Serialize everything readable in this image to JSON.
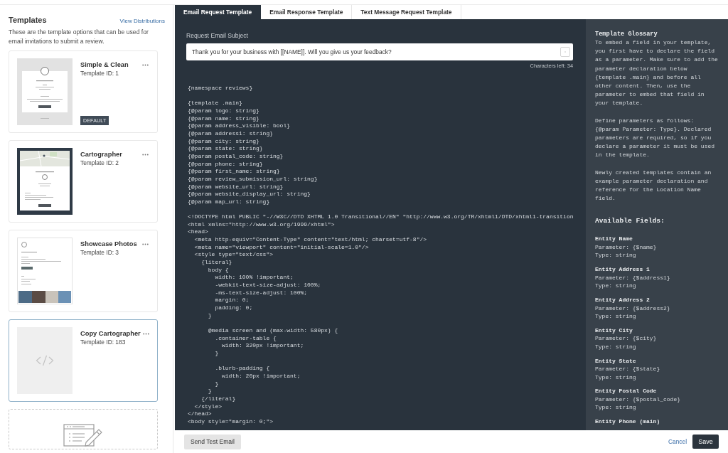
{
  "sidebar": {
    "title": "Templates",
    "link": "View Distributions",
    "description": "These are the template options that can be used for email invitations to submit a review.",
    "templates": [
      {
        "name": "Simple & Clean",
        "template_id": "Template ID: 1",
        "badge": "DEFAULT",
        "kind": "simple",
        "selected": false
      },
      {
        "name": "Cartographer",
        "template_id": "Template ID: 2",
        "kind": "map",
        "selected": false
      },
      {
        "name": "Showcase Photos",
        "template_id": "Template ID: 3",
        "kind": "photos",
        "selected": false
      },
      {
        "name": "Copy Cartographer",
        "template_id": "Template ID: 183",
        "kind": "code",
        "selected": true
      }
    ]
  },
  "tabs": [
    {
      "label": "Email Request Template",
      "selected": true
    },
    {
      "label": "Email Response Template",
      "selected": false
    },
    {
      "label": "Text Message Request Template",
      "selected": false
    }
  ],
  "editor": {
    "subject": {
      "label": "Request Email Subject",
      "value": "Thank you for your business with [[NAME]]. Will you give us your feedback?",
      "counter": "Characters left: 34"
    },
    "code": "{namespace reviews}\n\n{template .main}\n{@param logo: string}\n{@param name: string}\n{@param address_visible: bool}\n{@param address1: string}\n{@param city: string}\n{@param state: string}\n{@param postal_code: string}\n{@param phone: string}\n{@param first_name: string}\n{@param review_submission_url: string}\n{@param website_url: string}\n{@param website_display_url: string}\n{@param map_url: string}\n\n<!DOCTYPE html PUBLIC \"-//W3C//DTD XHTML 1.0 Transitional//EN\" \"http://www.w3.org/TR/xhtml1/DTD/xhtml1-transition\n<html xmlns=\"http://www.w3.org/1999/xhtml\">\n<head>\n  <meta http-equiv=\"Content-Type\" content=\"text/html; charset=utf-8\"/>\n  <meta name=\"viewport\" content=\"initial-scale=1.0\"/>\n  <style type=\"text/css\">\n    {literal}\n      body {\n        width: 100% !important;\n        -webkit-text-size-adjust: 100%;\n        -ms-text-size-adjust: 100%;\n        margin: 0;\n        padding: 0;\n      }\n\n      @media screen and (max-width: 580px) {\n        .container-table {\n          width: 320px !important;\n        }\n\n        .blurb-padding {\n          width: 20px !important;\n        }\n      }\n    {/literal}\n  </style>\n</head>\n<body style=\"margin: 0;\">"
  },
  "glossary": {
    "title": "Template Glossary",
    "paragraphs": [
      "To embed a field in your template, you first have to declare the field as a parameter. Make sure to add the parameter declaration below {template .main} and before all other content. Then, use the parameter to embed that field in your template.",
      "Define parameters as follows: {@param Parameter: Type}. Declared parameters are required, so if you declare a parameter it must be used in the template.",
      "Newly created templates contain an example parameter declaration and reference for the Location Name field."
    ],
    "fields_heading": "Available Fields:",
    "fields": [
      {
        "name": "Entity Name",
        "parameter": "Parameter: {$name}",
        "type": "Type: string"
      },
      {
        "name": "Entity Address 1",
        "parameter": "Parameter: {$address1}",
        "type": "Type: string"
      },
      {
        "name": "Entity Address 2",
        "parameter": "Parameter: {$address2}",
        "type": "Type: string"
      },
      {
        "name": "Entity City",
        "parameter": "Parameter: {$city}",
        "type": "Type: string"
      },
      {
        "name": "Entity State",
        "parameter": "Parameter: {$state}",
        "type": "Type: string"
      },
      {
        "name": "Entity Postal Code",
        "parameter": "Parameter: {$postal_code}",
        "type": "Type: string"
      },
      {
        "name": "Entity Phone (main)"
      }
    ]
  },
  "footer": {
    "test_button": "Send Test Email",
    "cancel": "Cancel",
    "save": "Save"
  }
}
